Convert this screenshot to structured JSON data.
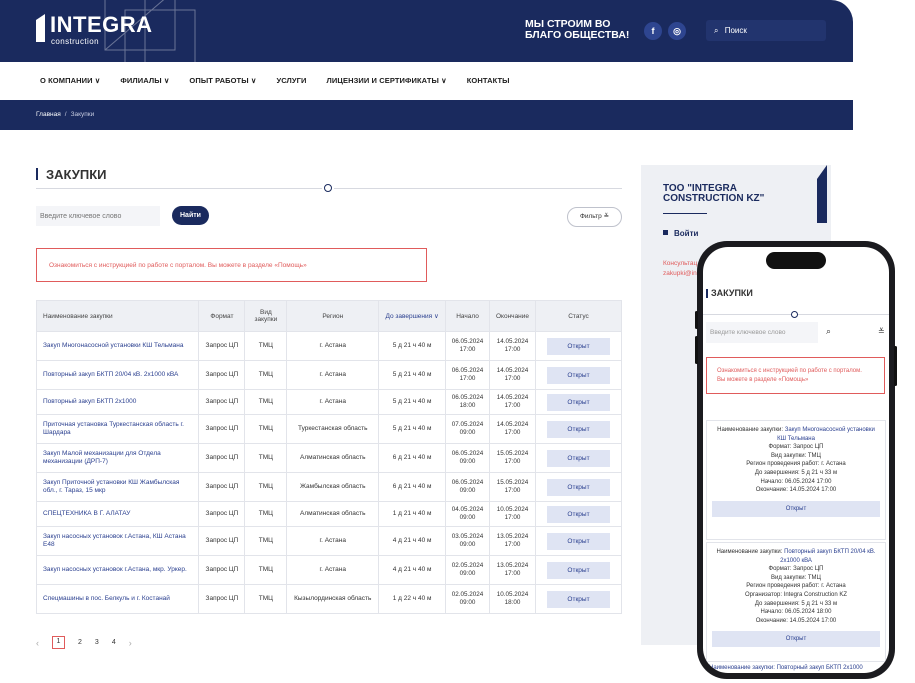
{
  "header": {
    "logo_text": "INTEGRA",
    "logo_sub": "construction",
    "slogan_line1": "МЫ СТРОИМ ВО",
    "slogan_line2": "БЛАГО ОБЩЕСТВА!",
    "facebook_icon": "f",
    "instagram_icon": "◎",
    "search_label": "Поиск"
  },
  "nav": [
    {
      "label": "О КОМПАНИИ",
      "chevron": "∨"
    },
    {
      "label": "ФИЛИАЛЫ",
      "chevron": "∨"
    },
    {
      "label": "ОПЫТ РАБОТЫ",
      "chevron": "∨"
    },
    {
      "label": "УСЛУГИ",
      "chevron": ""
    },
    {
      "label": "ЛИЦЕНЗИИ И СЕРТИФИКАТЫ",
      "chevron": "∨"
    },
    {
      "label": "КОНТАКТЫ",
      "chevron": ""
    }
  ],
  "breadcrumb": {
    "home": "Главная",
    "separator": "/",
    "current": "Закупки"
  },
  "main": {
    "title": "ЗАКУПКИ",
    "search_placeholder": "Введите ключевое слово",
    "find_label": "Найти",
    "filter_label": "Фильтр",
    "filter_icon": "≚",
    "notice": "Ознакомиться с инструкцией по работе с порталом. Вы можете в разделе «Помощь»"
  },
  "table": {
    "headers": [
      "Наименование закупки",
      "Формат",
      "Вид закупки",
      "Регион",
      "До завершения",
      "Начало",
      "Окончание",
      "Статус"
    ],
    "sort_icon": "∨",
    "rows": [
      {
        "name": "Закуп Многонасосной установки КШ Тельмана",
        "format": "Запрос ЦП",
        "kind": "ТМЦ",
        "region": "г. Астана",
        "left": "5 д 21 ч 40 м",
        "start_d": "06.05.2024",
        "start_t": "17:00",
        "end_d": "14.05.2024",
        "end_t": "17:00",
        "status": "Открыт"
      },
      {
        "name": "Повторный закуп БКТП 20/04 кВ. 2х1000 кВА",
        "format": "Запрос ЦП",
        "kind": "ТМЦ",
        "region": "г. Астана",
        "left": "5 д 21 ч 40 м",
        "start_d": "06.05.2024",
        "start_t": "17:00",
        "end_d": "14.05.2024",
        "end_t": "17:00",
        "status": "Открыт"
      },
      {
        "name": "Повторный закуп БКТП 2х1000",
        "format": "Запрос ЦП",
        "kind": "ТМЦ",
        "region": "г. Астана",
        "left": "5 д 21 ч 40 м",
        "start_d": "06.05.2024",
        "start_t": "18:00",
        "end_d": "14.05.2024",
        "end_t": "17:00",
        "status": "Открыт"
      },
      {
        "name": "Приточная установка Туркестанская область г. Шардара",
        "format": "Запрос ЦП",
        "kind": "ТМЦ",
        "region": "Туркестанская область",
        "left": "5 д 21 ч 40 м",
        "start_d": "07.05.2024",
        "start_t": "09:00",
        "end_d": "14.05.2024",
        "end_t": "17:00",
        "status": "Открыт"
      },
      {
        "name": "Закуп Малой механизации для Отдела механизации (ДРП-7)",
        "format": "Запрос ЦП",
        "kind": "ТМЦ",
        "region": "Алматинская область",
        "left": "6 д 21 ч 40 м",
        "start_d": "06.05.2024",
        "start_t": "09:00",
        "end_d": "15.05.2024",
        "end_t": "17:00",
        "status": "Открыт"
      },
      {
        "name": "Закуп Приточной установки КШ Жамбылская обл., г. Тараз, 15 мкр",
        "format": "Запрос ЦП",
        "kind": "ТМЦ",
        "region": "Жамбылская область",
        "left": "6 д 21 ч 40 м",
        "start_d": "06.05.2024",
        "start_t": "09:00",
        "end_d": "15.05.2024",
        "end_t": "17:00",
        "status": "Открыт"
      },
      {
        "name": "СПЕЦТЕХНИКА В Г. АЛАТАУ",
        "format": "Запрос ЦП",
        "kind": "ТМЦ",
        "region": "Алматинская область",
        "left": "1 д 21 ч 40 м",
        "start_d": "04.05.2024",
        "start_t": "09:00",
        "end_d": "10.05.2024",
        "end_t": "17:00",
        "status": "Открыт"
      },
      {
        "name": "Закуп насосных установок г.Астана, КШ Астана Е48",
        "format": "Запрос ЦП",
        "kind": "ТМЦ",
        "region": "г. Астана",
        "left": "4 д 21 ч 40 м",
        "start_d": "03.05.2024",
        "start_t": "09:00",
        "end_d": "13.05.2024",
        "end_t": "17:00",
        "status": "Открыт"
      },
      {
        "name": "Закуп насосных установок г.Астана, мкр. Уркер.",
        "format": "Запрос ЦП",
        "kind": "ТМЦ",
        "region": "г. Астана",
        "left": "4 д 21 ч 40 м",
        "start_d": "02.05.2024",
        "start_t": "09:00",
        "end_d": "13.05.2024",
        "end_t": "17:00",
        "status": "Открыт"
      },
      {
        "name": "Спецмашины в пос. Белкуль и г. Костанай",
        "format": "Запрос ЦП",
        "kind": "ТМЦ",
        "region": "Кызылординская область",
        "left": "1 д 22 ч 40 м",
        "start_d": "02.05.2024",
        "start_t": "09:00",
        "end_d": "10.05.2024",
        "end_t": "18:00",
        "status": "Открыт"
      }
    ]
  },
  "pagination": {
    "prev": "‹",
    "pages": [
      "1",
      "2",
      "3",
      "4"
    ],
    "current": "1",
    "next": "›"
  },
  "sidebar": {
    "company_line1": "ТОО \"INTEGRA",
    "company_line2": "CONSTRUCTION KZ\"",
    "login": "Войти",
    "contact_line1": "Консультац",
    "contact_line2": "zakupki@in"
  },
  "mobile": {
    "title": "ЗАКУПКИ",
    "search_placeholder": "Введите ключевое слово",
    "search_icon": "⌕",
    "filter_icon": "≚",
    "notice_line1": "Ознакомиться с инструкцией по работе с порталом.",
    "notice_line2": "Вы можете в разделе «Помощь»",
    "card1": {
      "name_prefix": "Наименование закупки:",
      "name_link_a": "Закуп Многонасосной установки",
      "name_link_b": "КШ Тельмана",
      "format": "Формат: Запрос ЦП",
      "kind": "Вид закупки: ТМЦ",
      "region": "Регион проведения работ: г. Астана",
      "left": "До завершения: 5 д 21 ч 33 м",
      "start": "Начало: 06.05.2024 17:00",
      "end": "Окончание: 14.05.2024 17:00",
      "open": "Открыт"
    },
    "card2": {
      "name_prefix": "Наименование закупки:",
      "name_link_a": "Повторный закуп БКТП 20/04 кВ.",
      "name_link_b": "2х1000 кВА",
      "format": "Формат: Запрос ЦП",
      "kind": "Вид закупки: ТМЦ",
      "region": "Регион проведения работ: г. Астана",
      "org": "Организатор: Integra Construction KZ",
      "left": "До завершения: 5 д 21 ч 33 м",
      "start": "Начало: 06.05.2024 18:00",
      "end": "Окончание: 14.05.2024 17:00",
      "open": "Открыт"
    },
    "next_card_peek": "Наименование закупки: Повторный закуп БКТП 2х1000"
  }
}
